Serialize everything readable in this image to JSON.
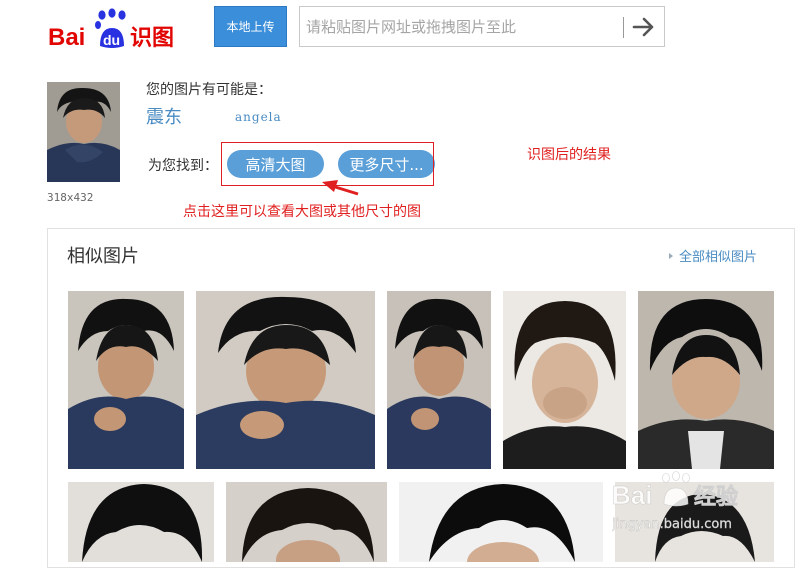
{
  "logo": {
    "bai": "Bai",
    "du": "du",
    "suffix": "识图"
  },
  "header": {
    "upload_label": "本地上传",
    "search_placeholder": "请粘贴图片网址或拖拽图片至此",
    "arrow_icon": "arrow-right-icon"
  },
  "result": {
    "size_text": "318x432",
    "maybe_text": "您的图片有可能是：",
    "guess_1": "震东",
    "guess_2": "angela",
    "found_label": "为您找到：",
    "hd_button": "高清大图",
    "more_sizes_button": "更多尺寸...",
    "annotation_right": "识图后的结果",
    "annotation_below": "点击这里可以查看大图或其他尺寸的图"
  },
  "similar": {
    "title": "相似图片",
    "all_link": "全部相似图片"
  },
  "watermark": {
    "brand": "Bai",
    "brand_cn": "经验",
    "url": "jingyan.baidu.com"
  },
  "colors": {
    "accent": "#3b8ed9",
    "link": "#4a8bc2",
    "annotation": "#e02020",
    "baidu_red": "#e10602",
    "baidu_blue": "#2932e1"
  }
}
